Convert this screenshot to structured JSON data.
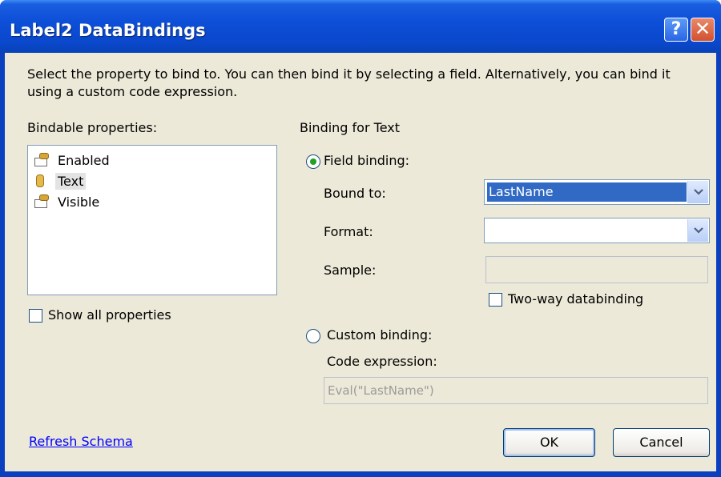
{
  "window": {
    "title": "Label2 DataBindings",
    "help_glyph": "?",
    "close_glyph": "✕"
  },
  "description": "Select the property to bind to. You can then bind it by selecting a field. Alternatively, you can bind it using a custom code expression.",
  "bindable": {
    "label": "Bindable properties:",
    "items": [
      {
        "label": "Enabled",
        "icon": "property-icon"
      },
      {
        "label": "Text",
        "icon": "database-icon",
        "selected": true
      },
      {
        "label": "Visible",
        "icon": "property-icon"
      }
    ],
    "show_all_label": "Show all properties",
    "show_all_checked": false
  },
  "binding": {
    "header": "Binding for Text",
    "field_binding_label": "Field binding:",
    "field_binding_selected": true,
    "bound_to_label": "Bound to:",
    "bound_to_value": "LastName",
    "format_label": "Format:",
    "format_value": "",
    "sample_label": "Sample:",
    "sample_value": "",
    "two_way_label": "Two-way databinding",
    "two_way_checked": false,
    "custom_binding_label": "Custom binding:",
    "custom_binding_selected": false,
    "code_expression_label": "Code expression:",
    "code_expression_value": "Eval(\"LastName\")"
  },
  "footer": {
    "refresh_label": "Refresh Schema",
    "ok_label": "OK",
    "cancel_label": "Cancel"
  },
  "colors": {
    "title_bar": "#0a48cc",
    "dialog_background": "#ece9d8",
    "selection": "#316ac5",
    "link": "#0000ff"
  }
}
